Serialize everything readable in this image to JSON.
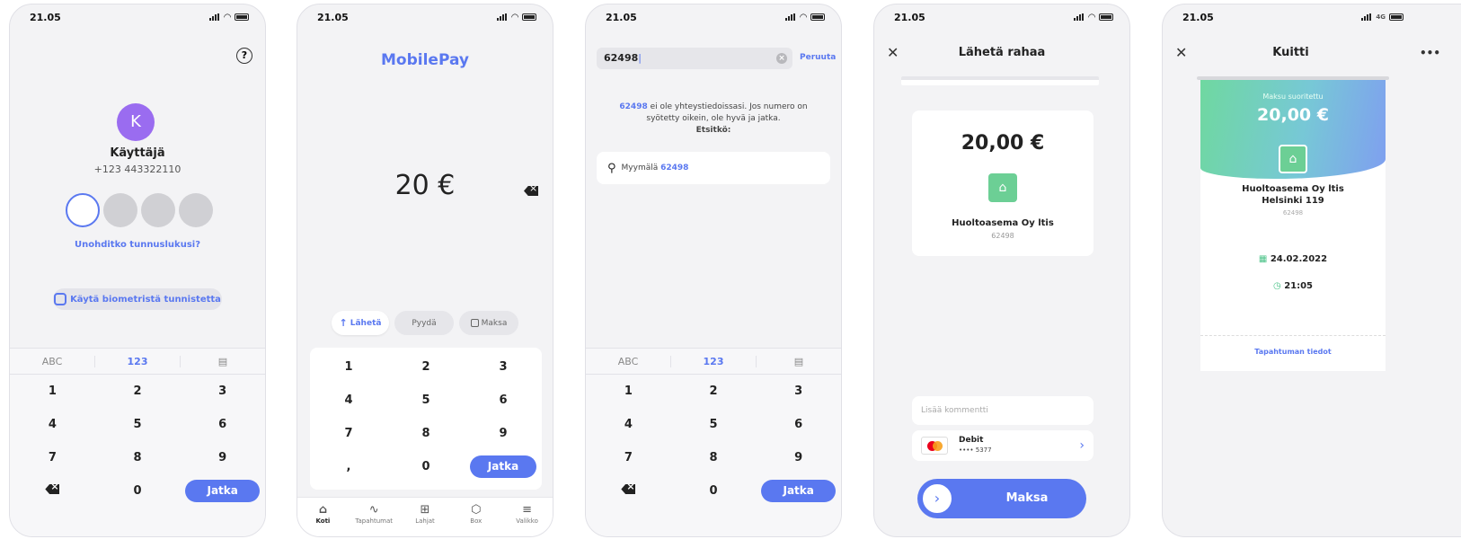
{
  "status_time": "21.05",
  "network_label": "4G",
  "screen1": {
    "help_icon": "?",
    "avatar_letter": "K",
    "user_name": "Käyttäjä",
    "user_phone": "+123 443322110",
    "forgot_link": "Unohditko tunnuslukusi?",
    "biometric_button": "Käytä biometristä tunnistetta",
    "keypad_tabs": [
      "ABC",
      "123",
      "▤"
    ],
    "keys": [
      "1",
      "2",
      "3",
      "4",
      "5",
      "6",
      "7",
      "8",
      "9",
      "0"
    ],
    "submit": "Jatka"
  },
  "screen2": {
    "logo": "MobilePay",
    "amount": "20 €",
    "actions": [
      "Lähetä",
      "Pyydä",
      "Maksa"
    ],
    "keys": [
      "1",
      "2",
      "3",
      "4",
      "5",
      "6",
      "7",
      "8",
      "9",
      ",",
      "0"
    ],
    "submit": "Jatka",
    "nav": [
      "Koti",
      "Tapahtumat",
      "Lahjat",
      "Box",
      "Valikko"
    ]
  },
  "screen3": {
    "search_value": "62498",
    "cancel": "Peruuta",
    "info_number": "62498",
    "info_text": " ei ole yhteystiedoissasi. Jos numero on syötetty oikein, ole hyvä ja jatka.",
    "info_bold": "Etsitkö:",
    "suggestion_prefix": "Myymälä ",
    "suggestion_number": "62498",
    "keypad_tabs": [
      "ABC",
      "123",
      "▤"
    ],
    "keys": [
      "1",
      "2",
      "3",
      "4",
      "5",
      "6",
      "7",
      "8",
      "9",
      "0"
    ],
    "submit": "Jatka"
  },
  "screen4": {
    "title": "Lähetä rahaa",
    "amount": "20,00 €",
    "merchant": "Huoltoasema Oy ltis",
    "merchant_id": "62498",
    "comment_placeholder": "Lisää kommentti",
    "card_type": "Debit",
    "card_number": "•••• 5377",
    "pay_button": "Maksa"
  },
  "screen5": {
    "title": "Kuitti",
    "status": "Maksu suoritettu",
    "amount": "20,00 €",
    "merchant_line1": "Huoltoasema Oy ltis",
    "merchant_line2": "Helsinki 119",
    "merchant_id": "62498",
    "date": "24.02.2022",
    "time": "21:05",
    "details_link": "Tapahtuman tiedot"
  },
  "colors": {
    "accent": "#5a78f0",
    "merchant_green": "#6ccf95",
    "avatar_purple": "#9a6cf0"
  }
}
